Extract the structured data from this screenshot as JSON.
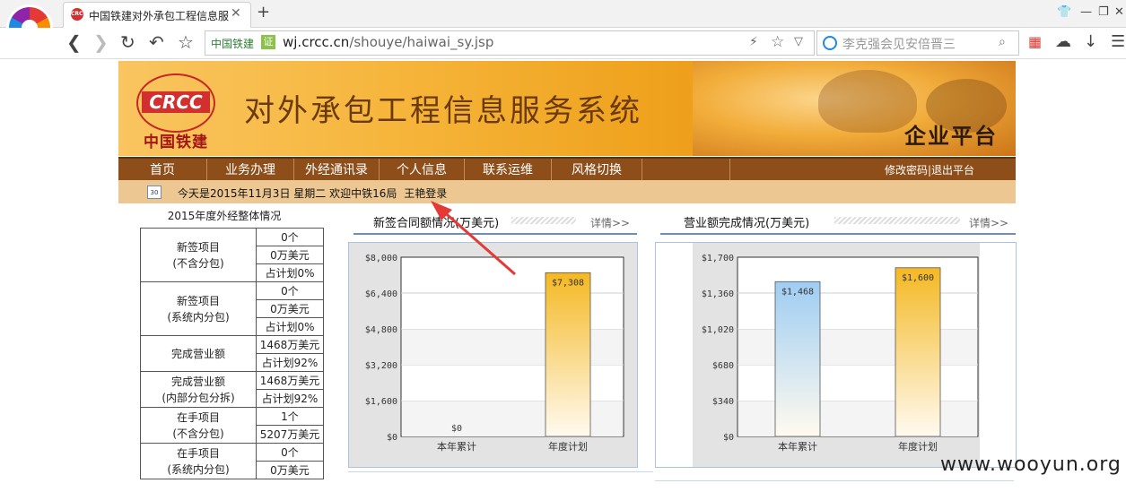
{
  "browser": {
    "tab_title": "中国铁建对外承包工程信息服",
    "url_site_badge": "中国铁建",
    "url_cert": "证",
    "url_host": "wj.crcc.cn",
    "url_path": "/shouye/haiwai_sy.jsp",
    "search_text": "李克强会见安倍晋三"
  },
  "header": {
    "logo_text": "CRCC",
    "org_name": "中国铁建",
    "system_title": "对外承包工程信息服务系统",
    "platform_label": "企业平台"
  },
  "menu": {
    "items": [
      "首页",
      "业务办理",
      "外经通讯录",
      "个人信息",
      "联系运维",
      "风格切换"
    ],
    "right_links": "修改密码|退出平台"
  },
  "info": {
    "calendar_label": "30",
    "date_text": "今天是2015年11月3日 星期二",
    "welcome_text": "欢迎中铁16局",
    "user_login": "王艳登录"
  },
  "overview": {
    "title": "2015年度外经整体情况",
    "rows": [
      {
        "label": [
          "新签项目",
          "(不含分包)"
        ],
        "values": [
          "0个",
          "0万美元",
          "占计划0%"
        ]
      },
      {
        "label": [
          "新签项目",
          "(系统内分包)"
        ],
        "values": [
          "0个",
          "0万美元",
          "占计划0%"
        ]
      },
      {
        "label": [
          "完成营业额"
        ],
        "values": [
          "1468万美元",
          "占计划92%"
        ]
      },
      {
        "label": [
          "完成营业额",
          "(内部分包分拆)"
        ],
        "values": [
          "1468万美元",
          "占计划92%"
        ]
      },
      {
        "label": [
          "在手项目",
          "(不含分包)"
        ],
        "values": [
          "1个",
          "5207万美元"
        ]
      },
      {
        "label": [
          "在手项目",
          "(系统内分包)"
        ],
        "values": [
          "0个",
          "0万美元"
        ]
      }
    ]
  },
  "panels": {
    "left": {
      "title": "新签合同额情况(万美元)",
      "more": "详情>>"
    },
    "right": {
      "title": "营业额完成情况(万美元)",
      "more": "详情>>"
    }
  },
  "chart_data": [
    {
      "type": "bar",
      "title": "新签合同额情况(万美元)",
      "categories": [
        "本年累计",
        "年度计划"
      ],
      "values": [
        0,
        7308
      ],
      "value_labels": [
        "$0",
        "$7,308"
      ],
      "ylim": [
        0,
        8000
      ],
      "yticks": [
        "$0",
        "$1,600",
        "$3,200",
        "$4,800",
        "$6,400",
        "$8,000"
      ],
      "bar_colors": [
        "#9fcdf2",
        "#f4b823"
      ],
      "grid": true
    },
    {
      "type": "bar",
      "title": "营业额完成情况(万美元)",
      "categories": [
        "本年累计",
        "年度计划"
      ],
      "values": [
        1468,
        1600
      ],
      "value_labels": [
        "$1,468",
        "$1,600"
      ],
      "ylim": [
        0,
        1700
      ],
      "yticks": [
        "$0",
        "$340",
        "$680",
        "$1,020",
        "$1,360",
        "$1,700"
      ],
      "bar_colors": [
        "#9fcdf2",
        "#f4b823"
      ],
      "grid": true
    }
  ],
  "watermark": "www.wooyun.org"
}
